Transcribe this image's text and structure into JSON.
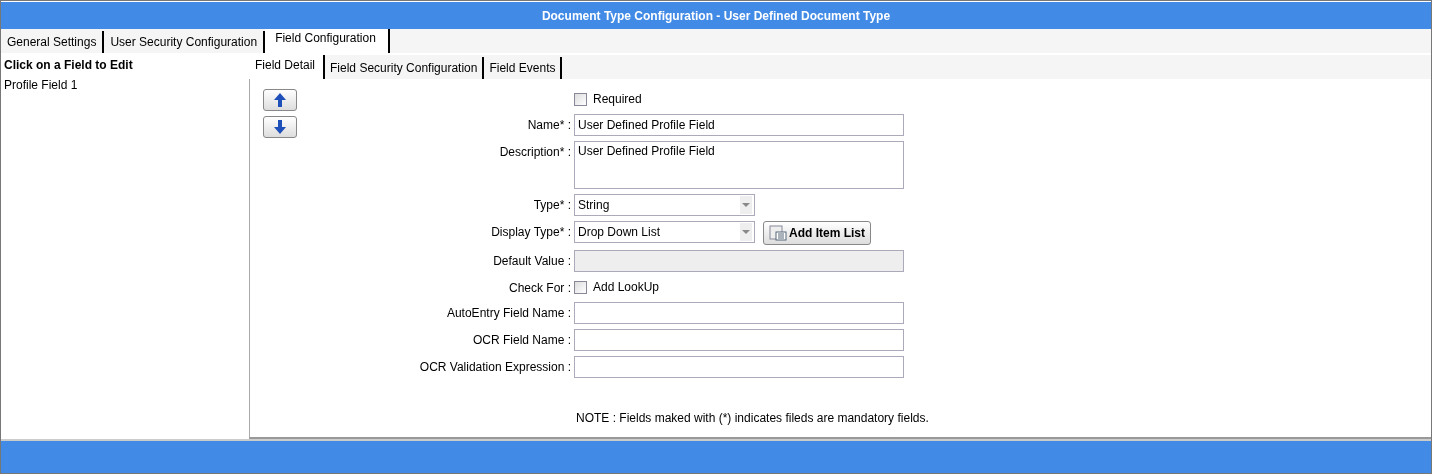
{
  "window": {
    "title": "Document Type Configuration - User Defined Document Type"
  },
  "tabs": [
    {
      "label": "General Settings",
      "selected": false
    },
    {
      "label": "User Security Configuration",
      "selected": false
    },
    {
      "label": "Field Configuration",
      "selected": true
    }
  ],
  "sidebar": {
    "heading": "Click on a Field to Edit",
    "items": [
      {
        "label": "Profile Field 1",
        "selected": false
      }
    ]
  },
  "subtabs": [
    {
      "label": "Field Detail",
      "selected": true
    },
    {
      "label": "Field Security Configuration",
      "selected": false
    },
    {
      "label": "Field Events",
      "selected": false
    }
  ],
  "form": {
    "rows": [
      {
        "kind": "checkbox",
        "option": "Required",
        "checked": false
      },
      {
        "kind": "text",
        "label": "Name* :",
        "value": "User Defined Profile Field"
      },
      {
        "kind": "textarea",
        "label": "Description* :",
        "value": "User Defined Profile Field"
      },
      {
        "kind": "select",
        "label": "Type* :",
        "value": "String"
      },
      {
        "kind": "select",
        "label": "Display Type* :",
        "value": "Drop Down List",
        "button": "Add Item List"
      },
      {
        "kind": "readonly",
        "label": "Default Value :"
      },
      {
        "kind": "checkbox",
        "label": "Check For :",
        "option": "Add LookUp",
        "checked": false
      },
      {
        "kind": "text",
        "label": "AutoEntry Field Name :"
      },
      {
        "kind": "text",
        "label": "OCR Field Name :"
      },
      {
        "kind": "text",
        "label": "OCR Validation Expression :"
      }
    ],
    "note": "NOTE : Fields maked with (*) indicates fileds are mandatory fields."
  }
}
